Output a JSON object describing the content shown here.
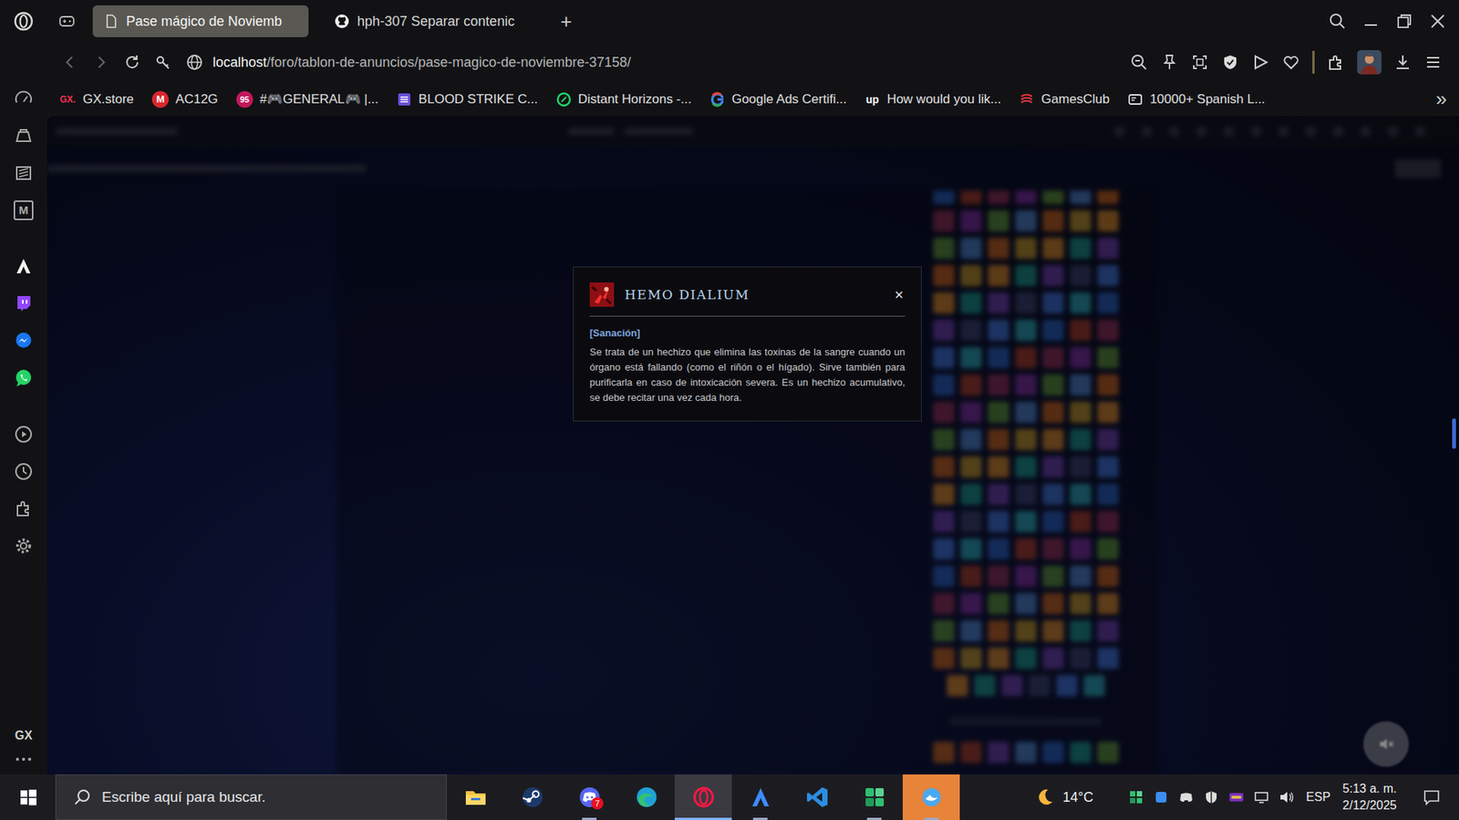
{
  "window": {
    "tabs": [
      {
        "label": "Pase mágico de Noviemb",
        "selected": true,
        "kind": "page"
      },
      {
        "label": "hph-307 Separar contenic",
        "selected": false,
        "kind": "github"
      }
    ],
    "new_tab": "+"
  },
  "address_bar": {
    "host": "localhost",
    "path": "/foro/tablon-de-anuncios/pase-magico-de-noviembre-37158/"
  },
  "bookmarks": [
    {
      "label": "GX.store",
      "kind": "gx",
      "logo": "GX."
    },
    {
      "label": "AC12G",
      "kind": "mega",
      "logo": "M"
    },
    {
      "label": "#🎮GENERAL🎮 |...",
      "kind": "badge",
      "logo": "95"
    },
    {
      "label": "BLOOD STRIKE C...",
      "kind": "list"
    },
    {
      "label": "Distant Horizons -...",
      "kind": "leaf"
    },
    {
      "label": "Google Ads Certifi...",
      "kind": "google"
    },
    {
      "label": "How would you lik...",
      "kind": "upwork",
      "logo": "up"
    },
    {
      "label": "GamesClub",
      "kind": "games"
    },
    {
      "label": "10000+ Spanish L...",
      "kind": "card"
    }
  ],
  "bookmarks_more": "»",
  "sidebar": {
    "groups": [
      [
        {
          "kind": "speed"
        },
        {
          "kind": "store"
        },
        {
          "kind": "news"
        },
        {
          "kind": "mega",
          "logo": "M"
        }
      ],
      [
        {
          "kind": "aria"
        },
        {
          "kind": "twitch"
        },
        {
          "kind": "messenger"
        },
        {
          "kind": "whatsapp"
        }
      ],
      [
        {
          "kind": "player"
        },
        {
          "kind": "history"
        },
        {
          "kind": "extensions"
        },
        {
          "kind": "settings"
        }
      ]
    ],
    "brand": "GX"
  },
  "modal": {
    "title": "HEMO DIALIUM",
    "close": "×",
    "category": "[Sanación]",
    "description": "Se trata de un hechizo que elimina las toxinas de la sangre cuando un órgano está fallando (como el riñón o el hígado). Sirve también para purificarla en caso de intoxicación severa. Es un hechizo acumulativo, se debe recitar una vez cada hora."
  },
  "taskbar": {
    "search_placeholder": "Escribe aquí para buscar.",
    "apps": [
      {
        "kind": "explorer",
        "running": false,
        "selected": false,
        "flashing": false
      },
      {
        "kind": "steam",
        "running": false,
        "selected": false,
        "flashing": false
      },
      {
        "kind": "discord",
        "running": true,
        "selected": false,
        "flashing": false,
        "badge": "7"
      },
      {
        "kind": "edge",
        "running": false,
        "selected": false,
        "flashing": false
      },
      {
        "kind": "opera",
        "running": true,
        "selected": true,
        "flashing": false
      },
      {
        "kind": "arc",
        "running": true,
        "selected": false,
        "flashing": false
      },
      {
        "kind": "vscode",
        "running": false,
        "selected": false,
        "flashing": false
      },
      {
        "kind": "grid",
        "running": true,
        "selected": false,
        "flashing": false
      },
      {
        "kind": "bird",
        "running": true,
        "selected": false,
        "flashing": true
      }
    ],
    "weather": "14°C",
    "language": "ESP",
    "time": "5:13 a. m.",
    "date": "2/12/2025"
  }
}
